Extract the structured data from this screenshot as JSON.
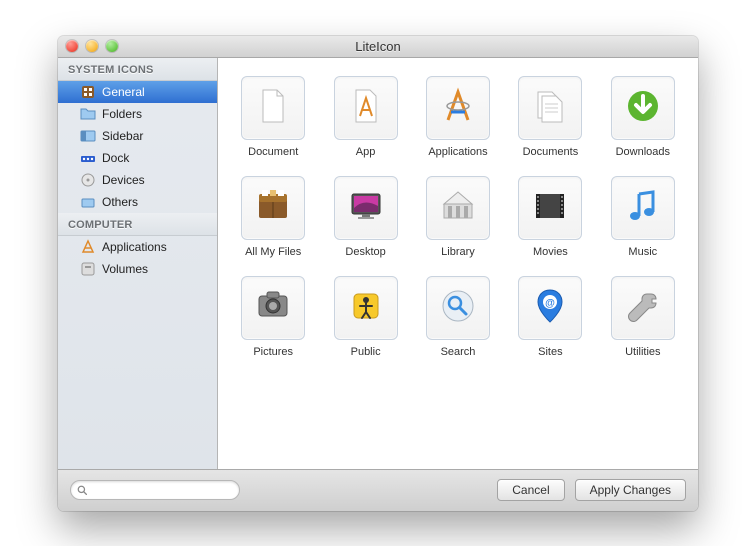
{
  "window": {
    "title": "LiteIcon"
  },
  "sidebar": {
    "sections": [
      {
        "header": "SYSTEM ICONS",
        "items": [
          {
            "label": "General",
            "icon": "general-icon",
            "selected": true
          },
          {
            "label": "Folders",
            "icon": "folder-icon",
            "selected": false
          },
          {
            "label": "Sidebar",
            "icon": "sidebar-icon",
            "selected": false
          },
          {
            "label": "Dock",
            "icon": "dock-icon",
            "selected": false
          },
          {
            "label": "Devices",
            "icon": "devices-icon",
            "selected": false
          },
          {
            "label": "Others",
            "icon": "others-icon",
            "selected": false
          }
        ]
      },
      {
        "header": "COMPUTER",
        "items": [
          {
            "label": "Applications",
            "icon": "applications-icon",
            "selected": false
          },
          {
            "label": "Volumes",
            "icon": "volumes-icon",
            "selected": false
          }
        ]
      }
    ]
  },
  "grid": {
    "icons": [
      {
        "label": "Document",
        "icon": "document-icon"
      },
      {
        "label": "App",
        "icon": "app-icon"
      },
      {
        "label": "Applications",
        "icon": "applications-big-icon"
      },
      {
        "label": "Documents",
        "icon": "documents-icon"
      },
      {
        "label": "Downloads",
        "icon": "downloads-icon"
      },
      {
        "label": "All My Files",
        "icon": "allmyfiles-icon"
      },
      {
        "label": "Desktop",
        "icon": "desktop-icon"
      },
      {
        "label": "Library",
        "icon": "library-icon"
      },
      {
        "label": "Movies",
        "icon": "movies-icon"
      },
      {
        "label": "Music",
        "icon": "music-icon"
      },
      {
        "label": "Pictures",
        "icon": "pictures-icon"
      },
      {
        "label": "Public",
        "icon": "public-icon"
      },
      {
        "label": "Search",
        "icon": "search-big-icon"
      },
      {
        "label": "Sites",
        "icon": "sites-icon"
      },
      {
        "label": "Utilities",
        "icon": "utilities-icon"
      }
    ]
  },
  "footer": {
    "search_placeholder": "",
    "cancel": "Cancel",
    "apply": "Apply Changes"
  }
}
